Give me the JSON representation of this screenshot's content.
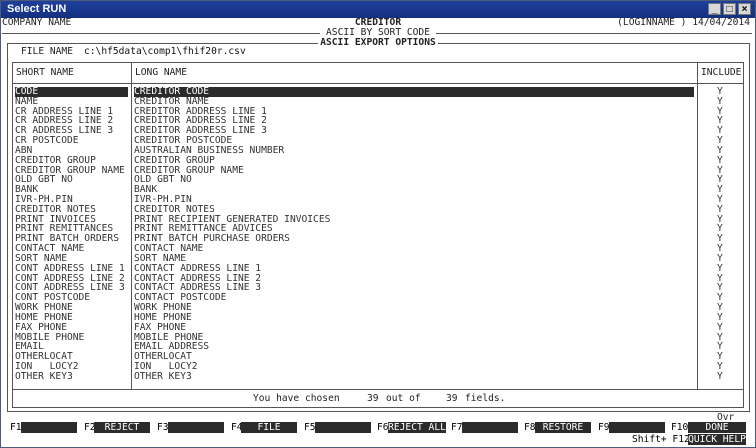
{
  "window": {
    "title": "Select RUN"
  },
  "header": {
    "company": "COMPANY NAME",
    "module": "CREDITOR",
    "login": "(LOGINNAME ) 14/04/2014",
    "subtitle": "ASCII BY SORT CODE",
    "options_title": "ASCII EXPORT OPTIONS"
  },
  "file": {
    "label": "FILE NAME",
    "value": "c:\\hf5data\\comp1\\fhif20r.csv"
  },
  "columns": {
    "short": "SHORT NAME",
    "long": "LONG NAME",
    "include": "INCLUDE"
  },
  "rows": [
    {
      "short": "CODE",
      "long": "CREDITOR CODE",
      "include": "Y"
    },
    {
      "short": "NAME",
      "long": "CREDITOR NAME",
      "include": "Y"
    },
    {
      "short": "CR ADDRESS LINE 1",
      "long": "CREDITOR ADDRESS LINE 1",
      "include": "Y"
    },
    {
      "short": "CR ADDRESS LINE 2",
      "long": "CREDITOR ADDRESS LINE 2",
      "include": "Y"
    },
    {
      "short": "CR ADDRESS LINE 3",
      "long": "CREDITOR ADDRESS LINE 3",
      "include": "Y"
    },
    {
      "short": "CR POSTCODE",
      "long": "CREDITOR POSTCODE",
      "include": "Y"
    },
    {
      "short": "ABN",
      "long": "AUSTRALIAN BUSINESS NUMBER",
      "include": "Y"
    },
    {
      "short": "CREDITOR GROUP",
      "long": "CREDITOR GROUP",
      "include": "Y"
    },
    {
      "short": "CREDITOR GROUP NAME",
      "long": "CREDITOR GROUP NAME",
      "include": "Y"
    },
    {
      "short": "OLD GBT NO",
      "long": "OLD GBT NO",
      "include": "Y"
    },
    {
      "short": "BANK",
      "long": "BANK",
      "include": "Y"
    },
    {
      "short": "IVR-PH.PIN",
      "long": "IVR-PH.PIN",
      "include": "Y"
    },
    {
      "short": "CREDITOR NOTES",
      "long": "CREDITOR NOTES",
      "include": "Y"
    },
    {
      "short": "PRINT INVOICES",
      "long": "PRINT RECIPIENT GENERATED INVOICES",
      "include": "Y"
    },
    {
      "short": "PRINT REMITTANCES",
      "long": "PRINT REMITTANCE ADVICES",
      "include": "Y"
    },
    {
      "short": "PRINT BATCH ORDERS",
      "long": "PRINT BATCH PURCHASE ORDERS",
      "include": "Y"
    },
    {
      "short": "CONTACT NAME",
      "long": "CONTACT NAME",
      "include": "Y"
    },
    {
      "short": "SORT NAME",
      "long": "SORT NAME",
      "include": "Y"
    },
    {
      "short": "CONT ADDRESS LINE 1",
      "long": "CONTACT ADDRESS LINE 1",
      "include": "Y"
    },
    {
      "short": "CONT ADDRESS LINE 2",
      "long": "CONTACT ADDRESS LINE 2",
      "include": "Y"
    },
    {
      "short": "CONT ADDRESS LINE 3",
      "long": "CONTACT ADDRESS LINE 3",
      "include": "Y"
    },
    {
      "short": "CONT POSTCODE",
      "long": "CONTACT POSTCODE",
      "include": "Y"
    },
    {
      "short": "WORK PHONE",
      "long": "WORK PHONE",
      "include": "Y"
    },
    {
      "short": "HOME PHONE",
      "long": "HOME PHONE",
      "include": "Y"
    },
    {
      "short": "FAX PHONE",
      "long": "FAX PHONE",
      "include": "Y"
    },
    {
      "short": "MOBILE PHONE",
      "long": "MOBILE PHONE",
      "include": "Y"
    },
    {
      "short": "EMAIL",
      "long": "EMAIL ADDRESS",
      "include": "Y"
    },
    {
      "short": "OTHERLOCAT",
      "long": "OTHERLOCAT",
      "include": "Y"
    },
    {
      "short": "ION   LOCY2",
      "long": "ION   LOCY2",
      "include": "Y"
    },
    {
      "short": "OTHER KEY3",
      "long": "OTHER KEY3",
      "include": "Y"
    }
  ],
  "footer": {
    "chosen_prefix": "You have chosen",
    "chosen_count": "39",
    "chosen_mid": "out of",
    "total_count": "39",
    "chosen_suffix": "fields.",
    "ovr": "Ovr"
  },
  "fkeys": [
    {
      "key": "F1",
      "label": ""
    },
    {
      "key": "F2",
      "label": "REJECT"
    },
    {
      "key": "F3",
      "label": ""
    },
    {
      "key": "F4",
      "label": "FILE"
    },
    {
      "key": "F5",
      "label": ""
    },
    {
      "key": "F6",
      "label": "REJECT ALL"
    },
    {
      "key": "F7",
      "label": ""
    },
    {
      "key": "F8",
      "label": "RESTORE"
    },
    {
      "key": "F9",
      "label": ""
    },
    {
      "key": "F10",
      "label": "DONE"
    }
  ],
  "shift_hint": {
    "key": "Shift+ F12",
    "label": "QUICK HELP"
  }
}
